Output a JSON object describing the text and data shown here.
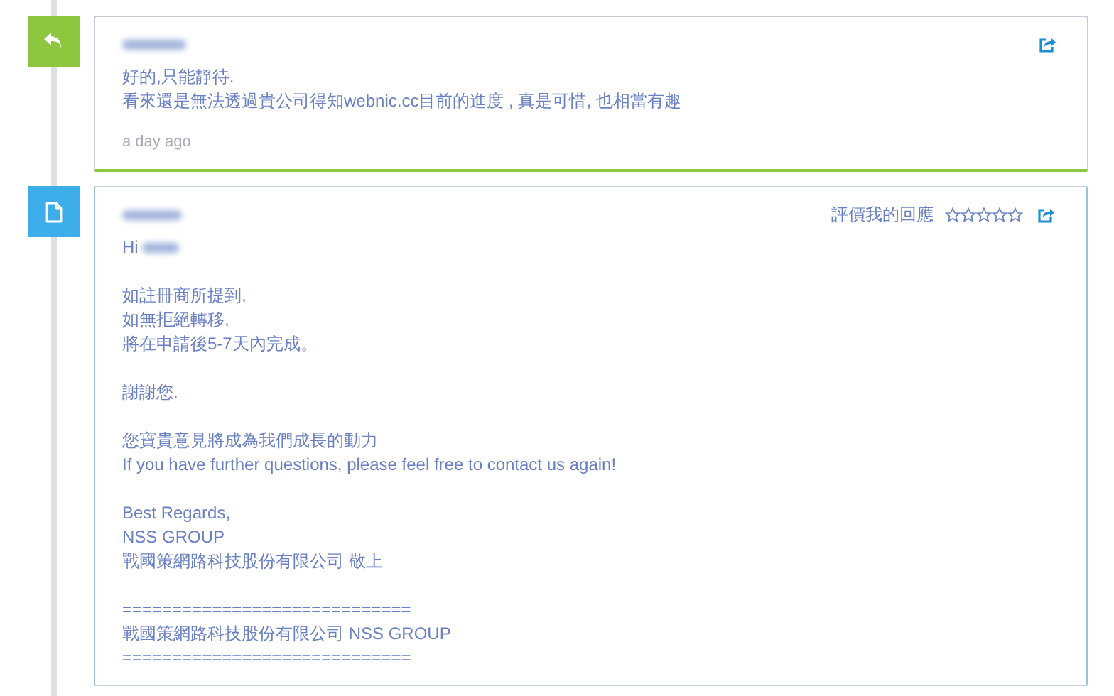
{
  "messages": [
    {
      "kind": "reply",
      "paragraphs": [
        [
          "好的,只能靜待.",
          "看來還是無法透過貴公司得知webnic.cc目前的進度 , 真是可惜, 也相當有趣"
        ]
      ],
      "time": "a day ago"
    },
    {
      "kind": "document",
      "rating_label": "評價我的回應",
      "stars": 0,
      "greeting": "Hi",
      "paragraphs": [
        [
          "如註冊商所提到,",
          "如無拒絕轉移,",
          "將在申請後5-7天內完成。"
        ],
        [
          "謝謝您."
        ],
        [
          "您寶貴意見將成為我們成長的動力",
          "If you have further questions, please feel free to contact us again!"
        ],
        [
          "Best Regards,",
          "NSS GROUP",
          "戰國策網路科技股份有限公司 敬上"
        ],
        [
          "=============================",
          "戰國策網路科技股份有限公司 NSS GROUP",
          "============================="
        ]
      ]
    }
  ]
}
